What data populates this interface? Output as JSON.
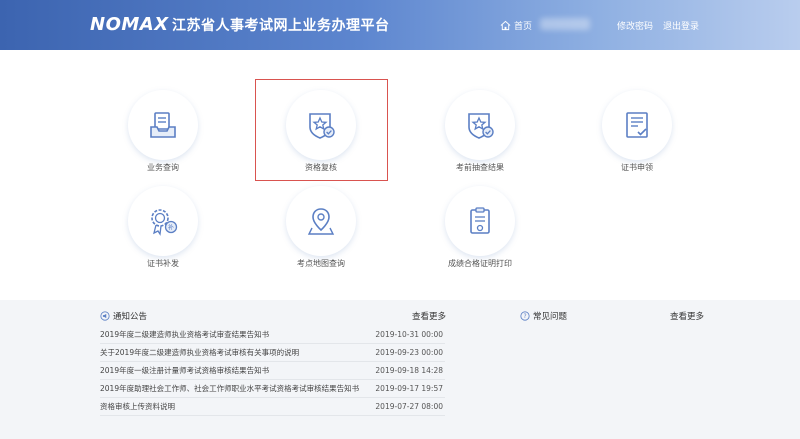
{
  "header": {
    "logo": "NOMAX",
    "title": "江苏省人事考试网上业务办理平台",
    "nav": {
      "home": "首页",
      "change_password": "修改密码",
      "logout": "退出登录"
    }
  },
  "tiles": [
    {
      "label": "业务查询",
      "icon": "tray-icon"
    },
    {
      "label": "资格复核",
      "icon": "badge-star-icon"
    },
    {
      "label": "考前抽查结果",
      "icon": "badge-star-icon"
    },
    {
      "label": "证书申领",
      "icon": "certificate-icon"
    },
    {
      "label": "证书补发",
      "icon": "award-medal-icon"
    },
    {
      "label": "考点地图查询",
      "icon": "map-pin-icon"
    },
    {
      "label": "成绩合格证明打印",
      "icon": "clipboard-icon"
    }
  ],
  "notices": {
    "heading": "通知公告",
    "more": "查看更多",
    "items": [
      {
        "title": "2019年度二级建造师执业资格考试审查结果告知书",
        "date": "2019-10-31 00:00"
      },
      {
        "title": "关于2019年度二级建造师执业资格考试审核有关事项的说明",
        "date": "2019-09-23 00:00"
      },
      {
        "title": "2019年度一级注册计量师考试资格审核结果告知书",
        "date": "2019-09-18 14:28"
      },
      {
        "title": "2019年度助理社会工作师、社会工作师职业水平考试资格考试审核结果告知书",
        "date": "2019-09-17 19:57"
      },
      {
        "title": "资格审核上传资料说明",
        "date": "2019-07-27 08:00"
      }
    ]
  },
  "faq": {
    "heading": "常见问题",
    "more": "查看更多"
  },
  "colors": {
    "header_start": "#3c64b0",
    "header_end": "#b9cdee",
    "icon_blue": "#5b7fc4",
    "highlight_red": "#d9534f",
    "panel_bg": "#f3f5f8"
  }
}
